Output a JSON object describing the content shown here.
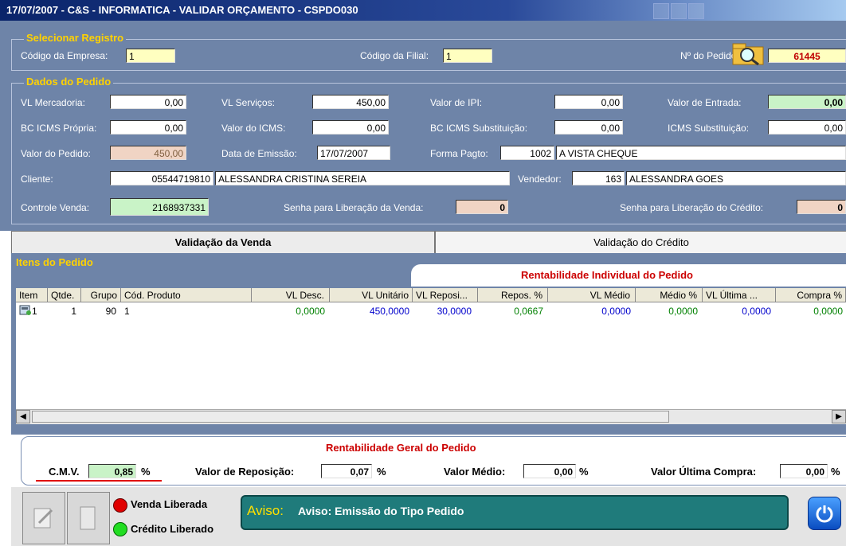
{
  "window": {
    "title": "17/07/2007 - C&S - INFORMATICA - VALIDAR ORÇAMENTO - CSPDO030"
  },
  "selecionar": {
    "title": "Selecionar Registro",
    "empresa_label": "Código da Empresa:",
    "empresa_value": "1",
    "filial_label": "Código da Filial:",
    "filial_value": "1",
    "pedido_label": "Nº do Pedido:",
    "pedido_value": "61445"
  },
  "dados": {
    "title": "Dados do Pedido",
    "vl_mercadoria_label": "VL Mercadoria:",
    "vl_mercadoria": "0,00",
    "vl_servicos_label": "VL Serviços:",
    "vl_servicos": "450,00",
    "valor_ipi_label": "Valor de IPI:",
    "valor_ipi": "0,00",
    "valor_entrada_label": "Valor de Entrada:",
    "valor_entrada": "0,00",
    "bc_icms_propria_label": "BC ICMS Própria:",
    "bc_icms_propria": "0,00",
    "valor_icms_label": "Valor do ICMS:",
    "valor_icms": "0,00",
    "bc_icms_subst_label": "BC ICMS Substituição:",
    "bc_icms_subst": "0,00",
    "icms_subst_label": "ICMS Substituição:",
    "icms_subst": "0,00",
    "valor_pedido_label": "Valor do Pedido:",
    "valor_pedido": "450,00",
    "data_emissao_label": "Data de Emissão:",
    "data_emissao": "17/07/2007",
    "forma_pagto_label": "Forma Pagto:",
    "forma_pagto_code": "1002",
    "forma_pagto_desc": "A VISTA CHEQUE",
    "cliente_label": "Cliente:",
    "cliente_code": "05544719810",
    "cliente_name": "ALESSANDRA CRISTINA SEREIA",
    "vendedor_label": "Vendedor:",
    "vendedor_code": "163",
    "vendedor_name": "ALESSANDRA GOES",
    "controle_venda_label": "Controle Venda:",
    "controle_venda": "2168937331",
    "senha_venda_label": "Senha para Liberação da Venda:",
    "senha_venda": "0",
    "senha_credito_label": "Senha para Liberação do Crédito:",
    "senha_credito": "0"
  },
  "tabs": {
    "venda": "Validação da Venda",
    "credito": "Validação do Crédito"
  },
  "itens": {
    "title": "Itens do Pedido",
    "rentab_individual": "Rentabilidade Individual do Pedido",
    "columns": [
      "Item",
      "Qtde.",
      "Grupo",
      "Cód. Produto",
      "VL Desc.",
      "VL Unitário",
      "VL Reposi...",
      "Repos. %",
      "VL Médio",
      "Médio %",
      "VL Última ...",
      "Compra %"
    ],
    "row": {
      "item": "1",
      "qtde": "1",
      "grupo": "90",
      "produto": "1",
      "desc": "0,0000",
      "unit": "450,0000",
      "repos": "30,0000",
      "repos_pct": "0,0667",
      "medio": "0,0000",
      "medio_pct": "0,0000",
      "ultima": "0,0000",
      "compra_pct": "0,0000"
    },
    "colors": {
      "green": "#008000",
      "blue": "#0000cc"
    }
  },
  "summary": {
    "title": "Rentabilidade Geral do Pedido",
    "cmv_label": "C.M.V.",
    "cmv": "0,85",
    "reposicao_label": "Valor de Reposição:",
    "reposicao": "0,07",
    "medio_label": "Valor Médio:",
    "medio": "0,00",
    "ultima_label": "Valor Última Compra:",
    "ultima": "0,00",
    "pct": "%"
  },
  "status": {
    "venda_liberada": "Venda Liberada",
    "credito_liberado": "Crédito Liberado",
    "aviso_prefix": "Aviso:",
    "aviso_text": "Aviso: Emissão do Tipo Pedido"
  }
}
